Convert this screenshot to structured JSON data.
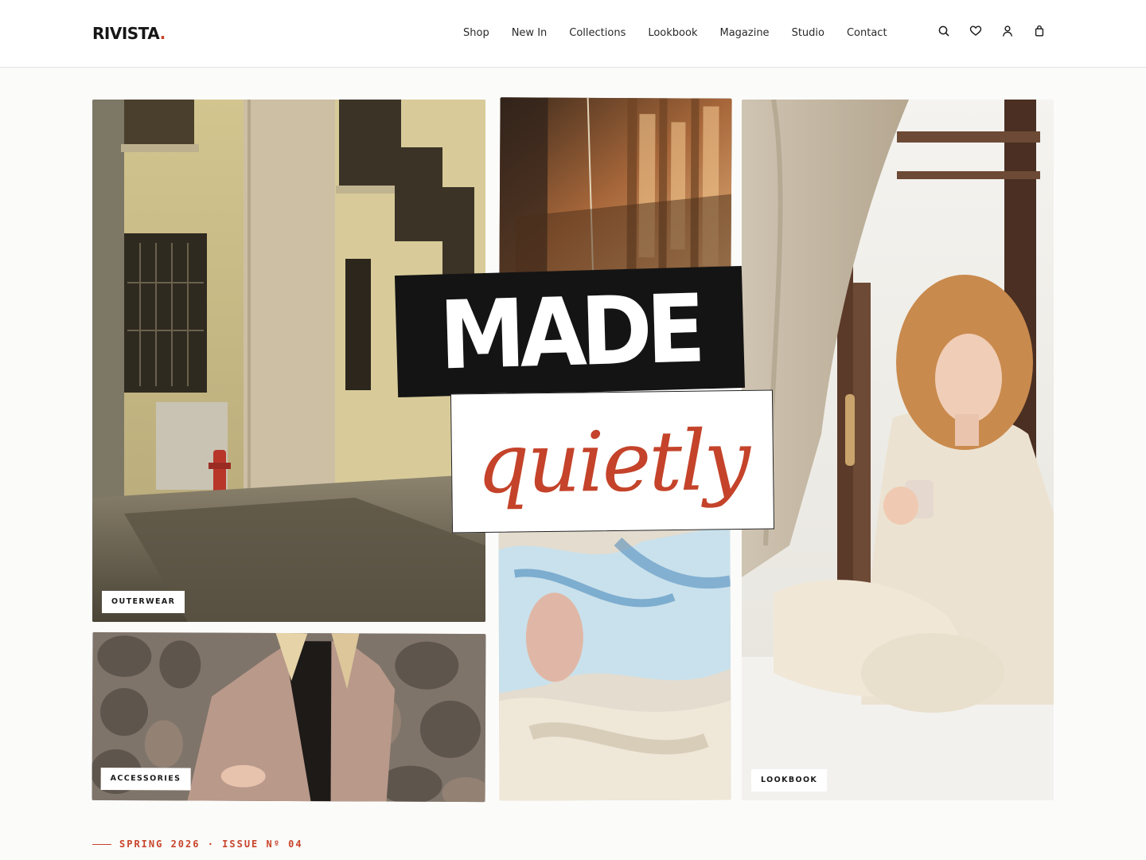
{
  "brand": {
    "name": "RIVISTA",
    "dot": "."
  },
  "nav": {
    "items": [
      "Shop",
      "New In",
      "Collections",
      "Lookbook",
      "Magazine",
      "Studio",
      "Contact"
    ]
  },
  "header_icons": [
    "search-icon",
    "heart-icon",
    "user-icon",
    "bag-icon"
  ],
  "headline": {
    "line1": "MADE",
    "line2": "quietly"
  },
  "tiles": {
    "outerwear": "OUTERWEAR",
    "accessories": "ACCESSORIES",
    "lookbook": "LOOKBOOK"
  },
  "issue": "SPRING 2026 · ISSUE Nº 04",
  "colors": {
    "accent": "#c8442a",
    "ink": "#141414",
    "background": "#fbfbfa"
  }
}
